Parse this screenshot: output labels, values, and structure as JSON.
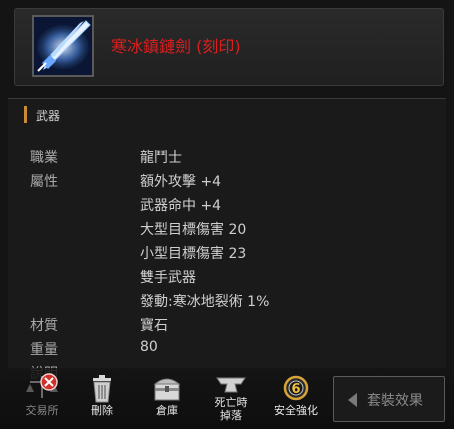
{
  "item": {
    "name": "寒冰鎮鏈劍 (刻印)",
    "icon": "ice-sword-icon",
    "name_color": "#e01d1d"
  },
  "section": {
    "title": "武器"
  },
  "properties": [
    {
      "label": "職業",
      "value": "龍鬥士"
    },
    {
      "label": "屬性",
      "value": "額外攻擊 +4"
    },
    {
      "label": "",
      "value": "武器命中 +4"
    },
    {
      "label": "",
      "value": "大型目標傷害  20"
    },
    {
      "label": "",
      "value": "小型目標傷害  23"
    },
    {
      "label": "",
      "value": "雙手武器"
    },
    {
      "label": "",
      "value": "發動:寒冰地裂術 1%"
    },
    {
      "label": "材質",
      "value": "寶石"
    },
    {
      "label": "重量",
      "value": "80"
    },
    {
      "label": "說明",
      "value": ""
    }
  ],
  "toolbar": {
    "exchange": "交易所",
    "delete": "刪除",
    "storage": "倉庫",
    "death_drop": "死亡時\n掉落",
    "safe_enhance": "安全強化",
    "safe_enhance_badge": "6",
    "set_effect": "套裝效果"
  },
  "colors": {
    "accent": "#c98b3a",
    "disabled": "#d0302a"
  }
}
